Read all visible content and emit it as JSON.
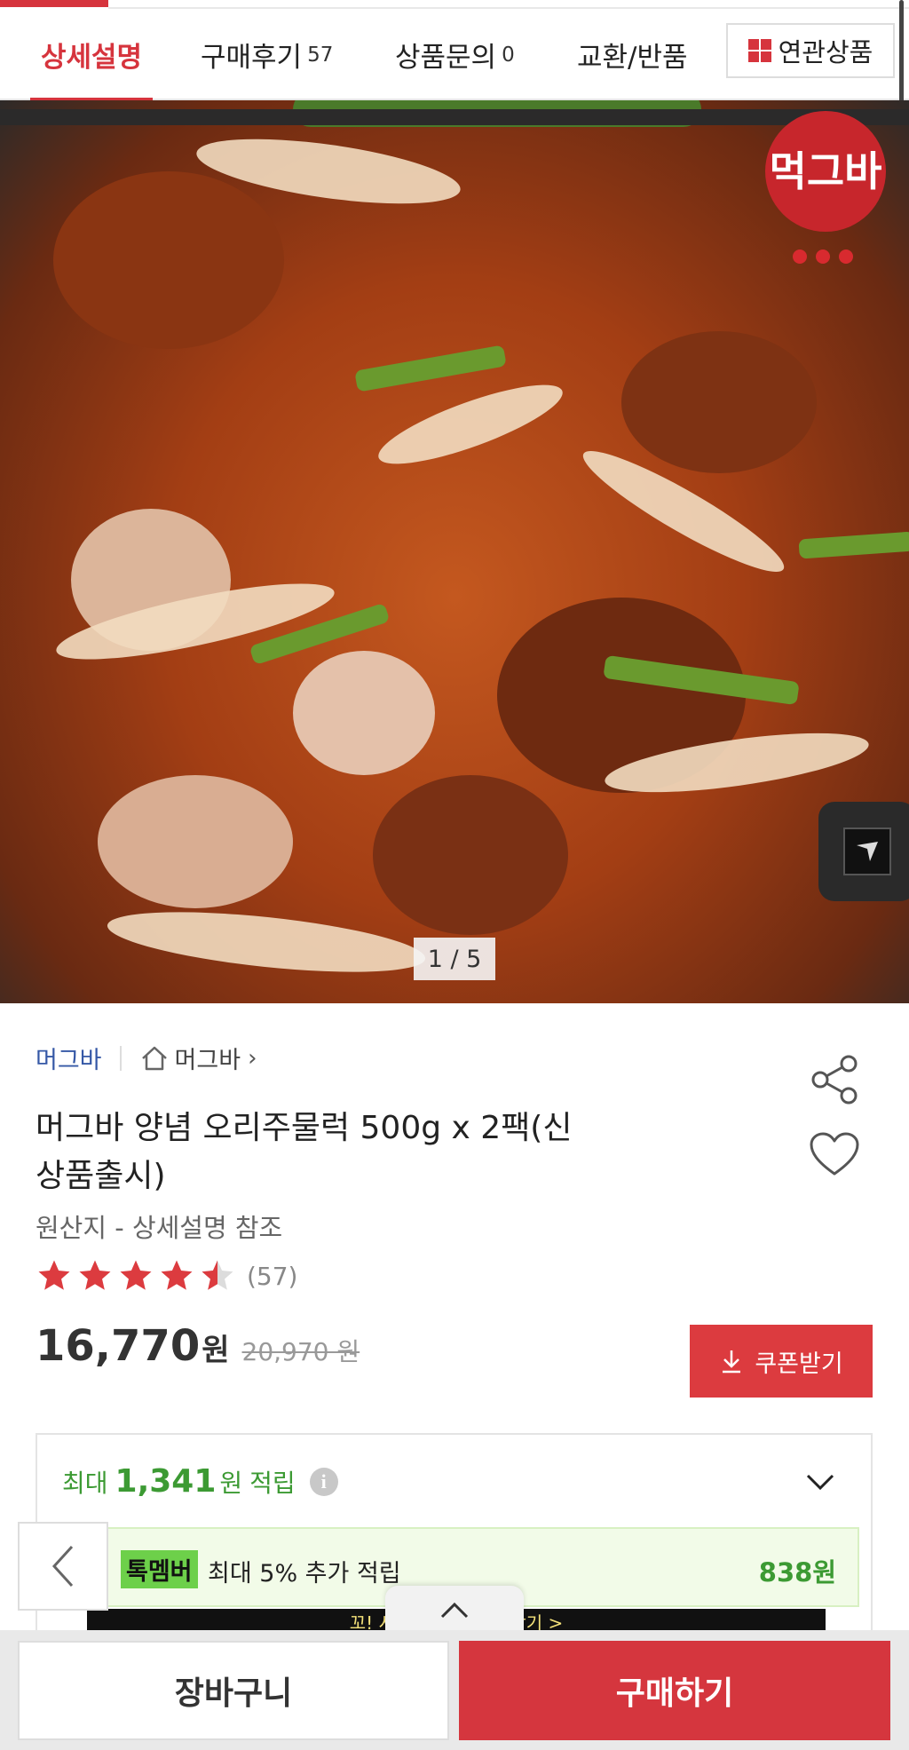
{
  "tabs": {
    "detail": "상세설명",
    "reviews": "구매후기",
    "reviews_count": "57",
    "qna": "상품문의",
    "qna_count": "0",
    "exchange": "교환/반품",
    "related": "연관상품"
  },
  "hero": {
    "logo_text": "먹그바",
    "counter": "1 / 5"
  },
  "product": {
    "brand": "머그바",
    "store": "머그바",
    "title": "머그바 양념 오리주물럭 500g x 2팩(신상품출시)",
    "origin": "원산지 - 상세설명 참조",
    "rating": 4.5,
    "rating_count": "(57)",
    "price": "16,770",
    "price_unit": "원",
    "original_price": "20,970 원",
    "coupon_label": "쿠폰받기"
  },
  "points": {
    "prefix": "최대",
    "amount": "1,341",
    "unit": "원",
    "suffix": "적립",
    "info_glyph": "i",
    "member_badge": "톡멤버",
    "member_text": "최대 5% 추가 적립",
    "member_amount": "838원",
    "banner_text": "꼬! 시작하고 적립 더 받기 >"
  },
  "bottom": {
    "cart": "장바구니",
    "buy": "구매하기"
  },
  "colors": {
    "accent": "#d6343d",
    "points_green": "#3c9a33",
    "brand_blue": "#3558a6"
  },
  "icons": [
    "grid-icon",
    "home-icon",
    "share-icon",
    "heart-icon",
    "download-icon",
    "info-icon",
    "chevron-down-icon",
    "chevron-left-icon",
    "chevron-up-icon"
  ]
}
